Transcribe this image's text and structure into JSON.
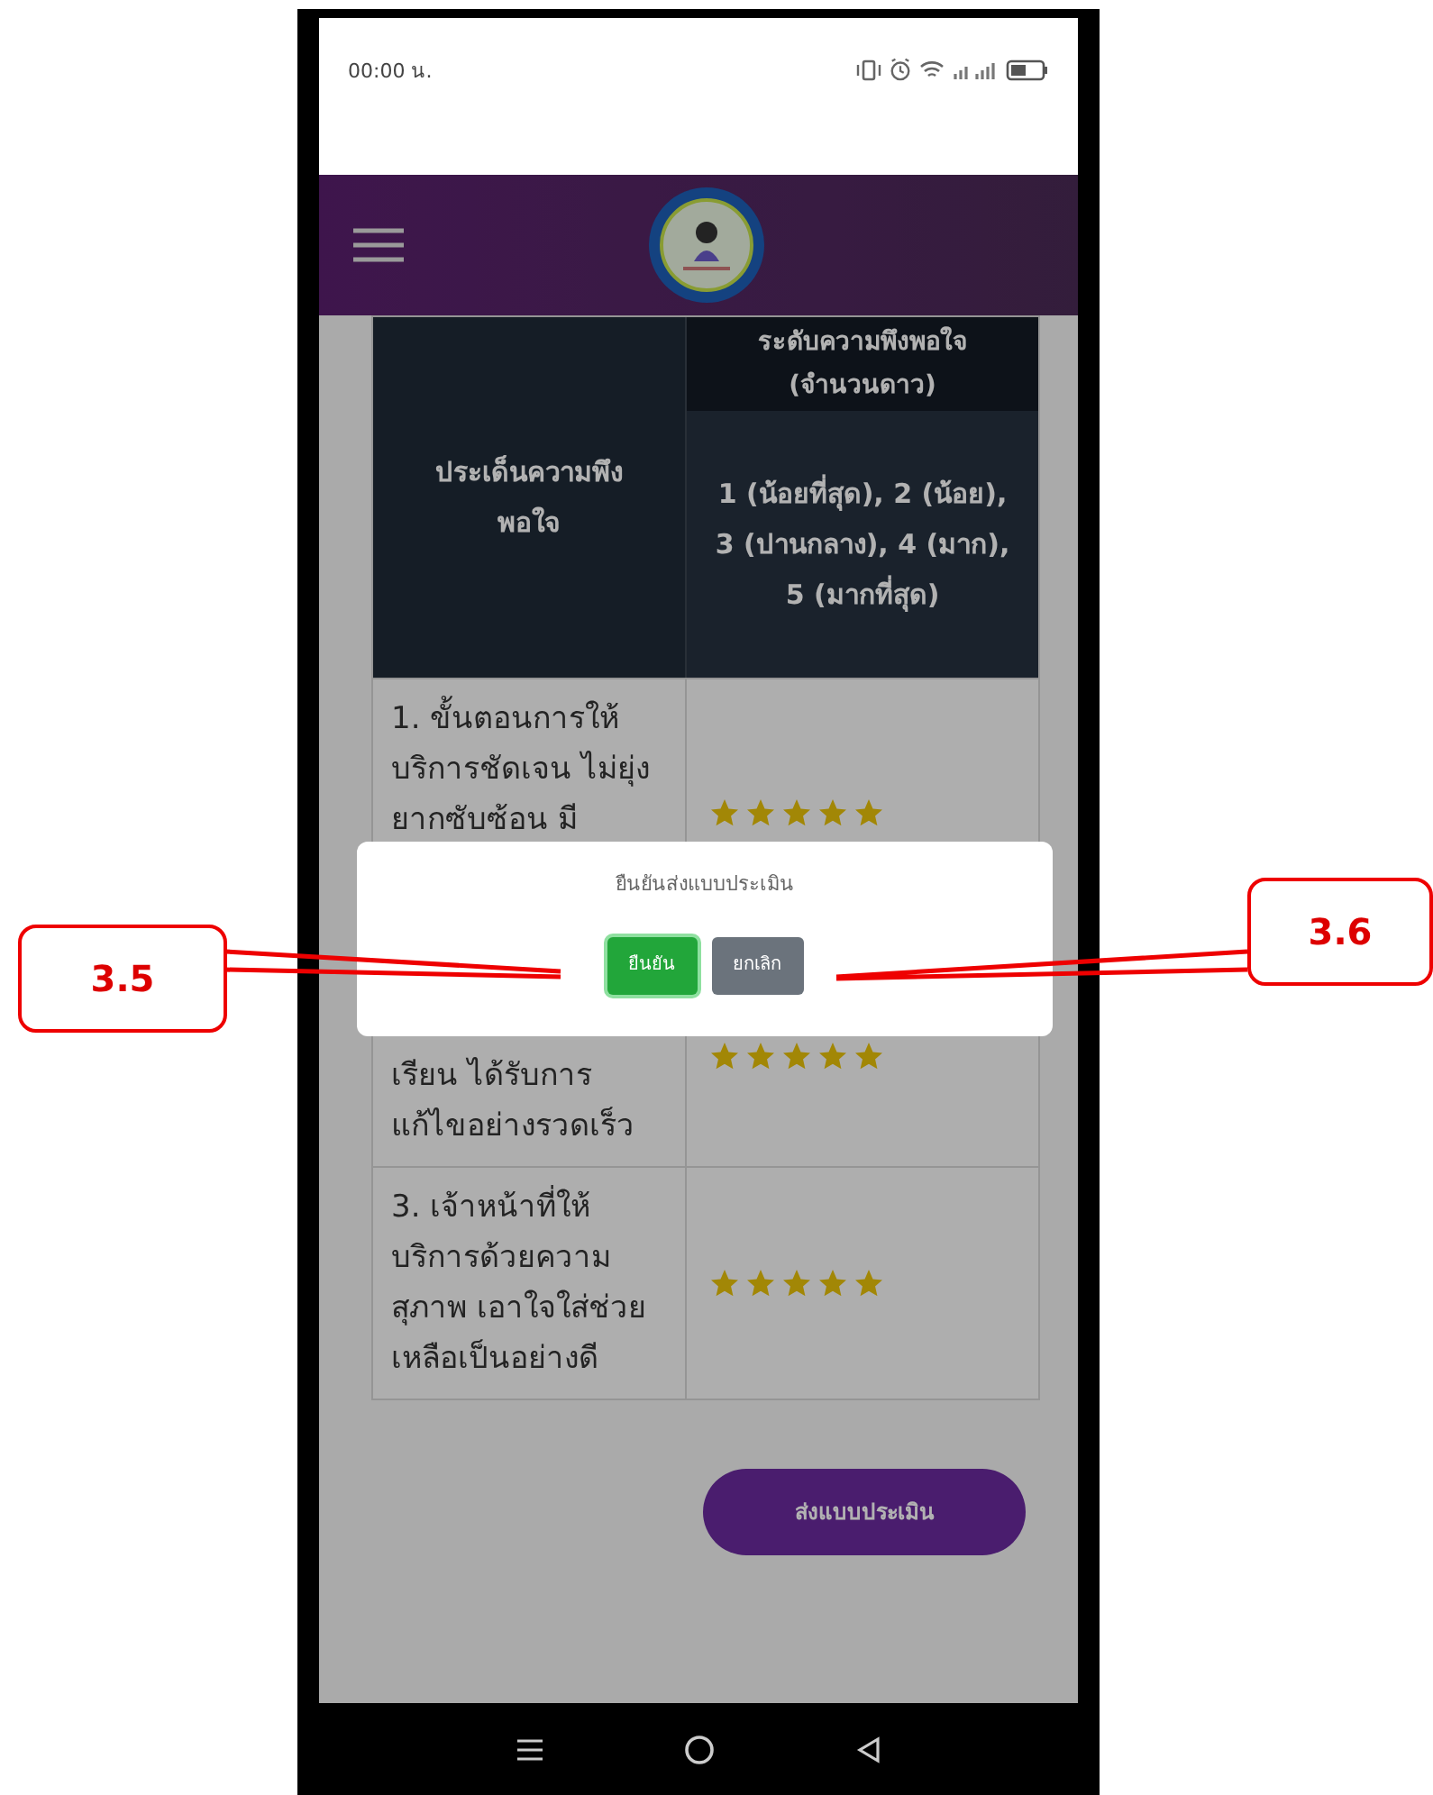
{
  "status_bar": {
    "time": "00:00 น."
  },
  "table": {
    "columns": [
      {
        "label": "ประเด็นความพึงพอใจ"
      },
      {
        "label": "ระดับความพึงพอใจ",
        "sublabel": "(จำนวนดาว)",
        "scale": "1 (น้อยที่สุด), 2 (น้อย), 3 (ปานกลาง), 4 (มาก), 5 (มากที่สุด)"
      }
    ],
    "rows": [
      {
        "text": "1. ขั้นตอนการให้บริการชัดเจน ไม่ยุ่งยากซับซ้อน มี",
        "stars": 5
      },
      {
        "text": "เรียน ได้รับการแก้ไขอย่างรวดเร็ว",
        "stars": 5
      },
      {
        "text": "3. เจ้าหน้าที่ให้บริการด้วยความสุภาพ เอาใจใส่ช่วยเหลือเป็นอย่างดี",
        "stars": 5
      }
    ]
  },
  "submit_button": {
    "label": "ส่งแบบประเมิน"
  },
  "dialog": {
    "message": "ยืนยันส่งแบบประเมิน",
    "buttons": [
      {
        "label": "ยืนยัน",
        "kind": "confirm"
      },
      {
        "label": "ยกเลิก",
        "kind": "cancel"
      }
    ]
  },
  "callouts": [
    {
      "label": "3.5"
    },
    {
      "label": "3.6"
    }
  ]
}
